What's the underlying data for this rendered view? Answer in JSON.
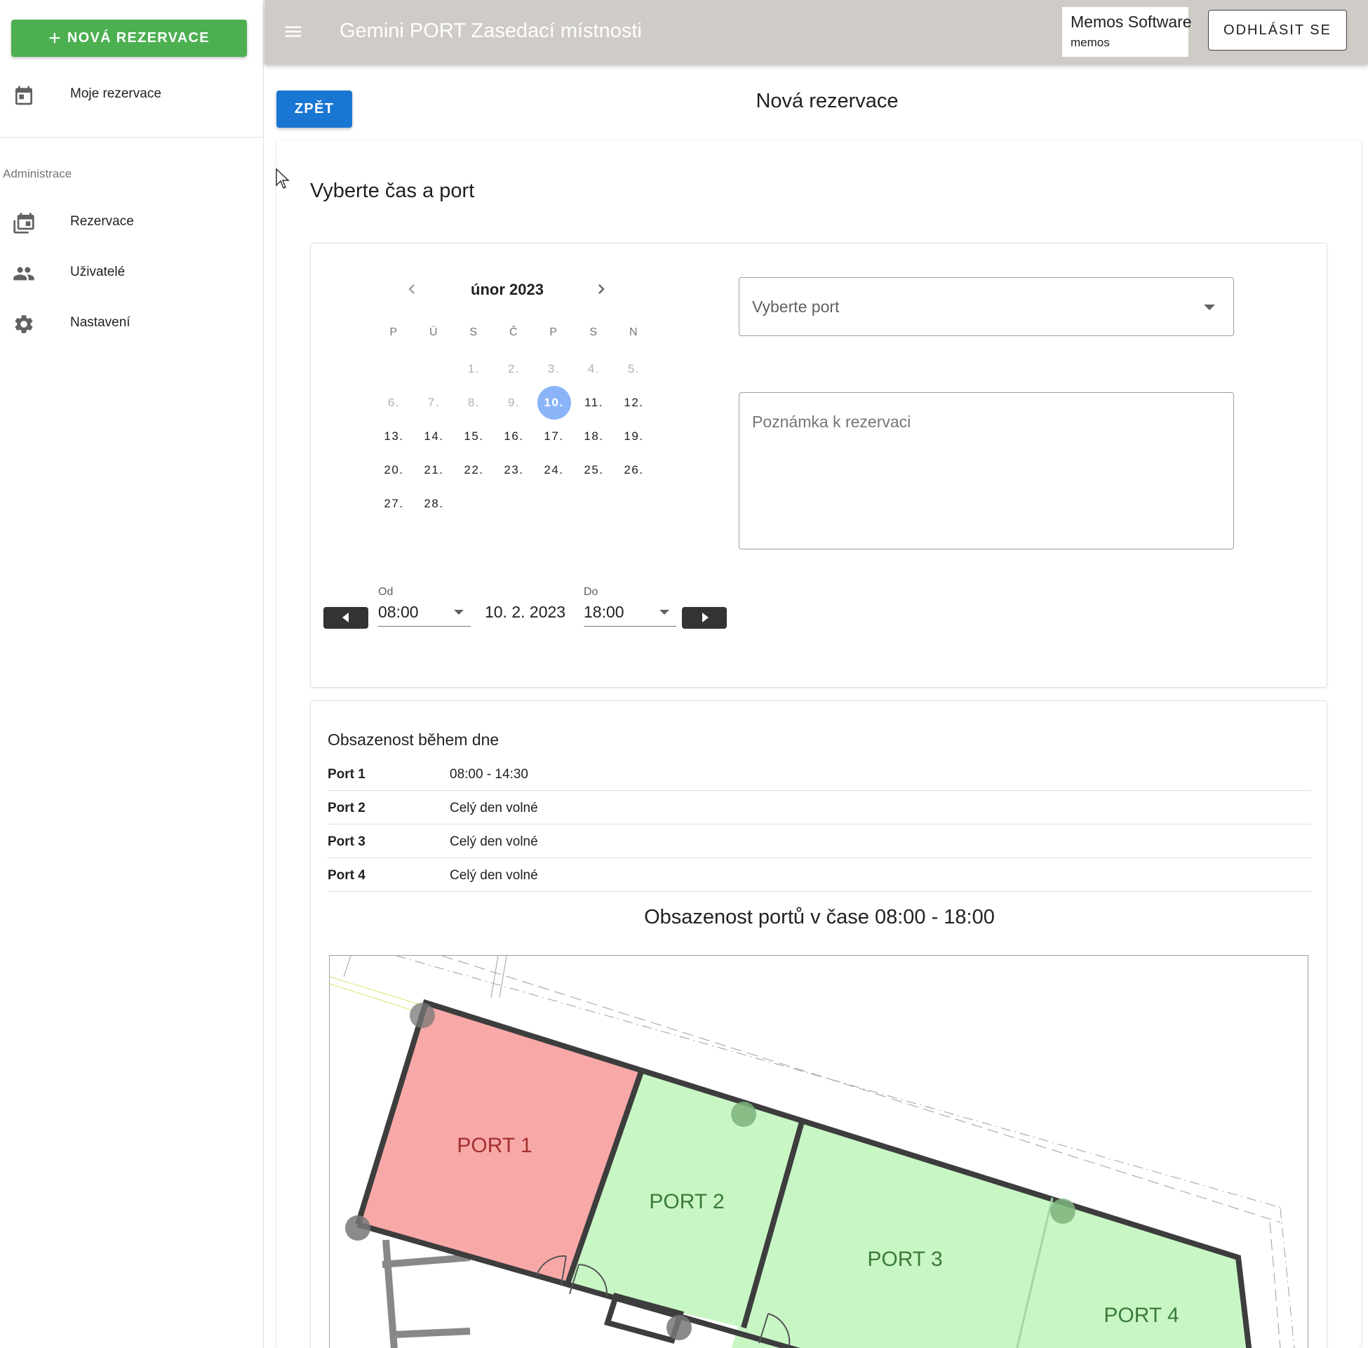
{
  "sidebar": {
    "new_button": "NOVÁ REZERVACE",
    "my_reservations": "Moje rezervace",
    "admin_header": "Administrace",
    "admin_items": [
      "Rezervace",
      "Uživatelé",
      "Nastavení"
    ]
  },
  "topbar": {
    "title": "Gemini PORT Zasedací místnosti",
    "company": "Memos Software",
    "login": "memos",
    "logout": "ODHLÁSIT SE"
  },
  "main": {
    "back": "ZPĚT",
    "page_title": "Nová rezervace",
    "section_title": "Vyberte čas a port"
  },
  "calendar": {
    "month": "únor 2023",
    "weekdays": [
      "P",
      "Ú",
      "S",
      "Č",
      "P",
      "S",
      "N"
    ],
    "weeks": [
      [
        "",
        "",
        "1.",
        "2.",
        "3.",
        "4.",
        "5."
      ],
      [
        "6.",
        "7.",
        "8.",
        "9.",
        "10.",
        "11.",
        "12."
      ],
      [
        "13.",
        "14.",
        "15.",
        "16.",
        "17.",
        "18.",
        "19."
      ],
      [
        "20.",
        "21.",
        "22.",
        "23.",
        "24.",
        "25.",
        "26."
      ],
      [
        "27.",
        "28.",
        "",
        "",
        "",
        "",
        ""
      ]
    ],
    "selected": "10.",
    "disabled": [
      "1.",
      "2.",
      "3.",
      "4.",
      "5.",
      "6.",
      "7.",
      "8.",
      "9."
    ]
  },
  "form": {
    "port_placeholder": "Vyberte port",
    "note_placeholder": "Poznámka k rezervaci",
    "from_label": "Od",
    "from_value": "08:00",
    "date": "10. 2. 2023",
    "to_label": "Do",
    "to_value": "18:00"
  },
  "occupancy": {
    "title": "Obsazenost během dne",
    "rows": [
      {
        "port": "Port 1",
        "value": "08:00 - 14:30"
      },
      {
        "port": "Port 2",
        "value": "Celý den volné"
      },
      {
        "port": "Port 3",
        "value": "Celý den volné"
      },
      {
        "port": "Port 4",
        "value": "Celý den volné"
      }
    ],
    "map_title": "Obsazenost portů v čase 08:00 - 18:00"
  },
  "map": {
    "rooms": [
      {
        "label": "PORT 1",
        "status": "occupied"
      },
      {
        "label": "PORT 2",
        "status": "free"
      },
      {
        "label": "PORT 3",
        "status": "free"
      },
      {
        "label": "PORT 4",
        "status": "free"
      }
    ],
    "colors": {
      "occupied": "#f9a8a8",
      "free": "#c8f7c5",
      "occupied_text": "#a33030",
      "free_text": "#3a7a3a"
    }
  },
  "colors": {
    "primary": "#1976d2",
    "success": "#4caf50",
    "topbar": "#cfccc7",
    "selected_day": "#8ab4f8"
  },
  "icons": [
    "calendar-icon",
    "calendar-multiple-icon",
    "users-icon",
    "gear-icon",
    "menu-icon",
    "chevron-left-icon",
    "chevron-right-icon",
    "dropdown-arrow-icon"
  ]
}
